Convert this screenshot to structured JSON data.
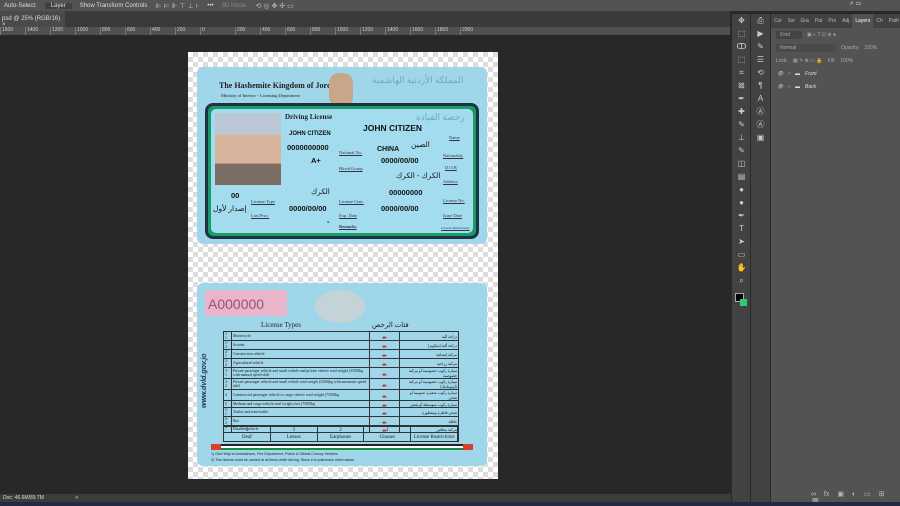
{
  "options_bar": {
    "auto_select": "Auto-Select:",
    "layer_select": "Layer",
    "show_transform": "Show Transform Controls",
    "mode_3d": "3D Mode:",
    "more": "•••"
  },
  "tab": {
    "title": "psd @ 25% (RGB/16)",
    "close": "×"
  },
  "ruler": [
    "1600",
    "1400",
    "1200",
    "1000",
    "800",
    "600",
    "400",
    "200",
    "0",
    "200",
    "400",
    "600",
    "800",
    "1000",
    "1200",
    "1400",
    "1600",
    "1800",
    "2000"
  ],
  "status": {
    "doc": "Doc: 46.6M/89.7M",
    "arrow": ">"
  },
  "panel": {
    "tabs": [
      "Col",
      "Sw",
      "Gra",
      "Pat",
      "Pro",
      "Adj",
      "Layers",
      "Ch",
      "Path"
    ],
    "active_tab": "Layers",
    "filter": "Kind",
    "blend": "Normal",
    "opacity_label": "Opacity:",
    "opacity": "100%",
    "lock": "Lock:",
    "fill_label": "Fill:",
    "fill": "100%",
    "layers": [
      "Front",
      "Back"
    ]
  },
  "front": {
    "kingdom": "The Hashemite Kingdom of Jordan",
    "ministry": "Ministry of Interior - Licensing Department",
    "ar_title": "المملكة الأردنية الهاشمية",
    "title": "Driving License",
    "ar_license": "رخصة القيادة",
    "name_big": "JOHN CITIZEN",
    "name_small": "JOHN CITIZEN",
    "name_label": "Name",
    "national_no": "0000000000",
    "national_label": "National No.",
    "nationality": "CHINA",
    "nationality_ar": "الصين",
    "nationality_label": "Nationality",
    "blood": "A+",
    "blood_label": "Blood Group",
    "dob": "0000/00/00",
    "dob_label": "D.O.B",
    "address": "الكرك - الكرك",
    "address_label": "Address",
    "license_type": "00",
    "license_type_label": "License Type",
    "license_cent": "الكرك",
    "license_cent_label": "License Cent.",
    "license_no": "00000000",
    "license_no_label": "License No.",
    "last_proc": "إصدار لأول",
    "last_proc_label": "Last Proc.",
    "exp": "0000/00/00",
    "exp_label": "Exp. Date",
    "issue": "0000/00/00",
    "issue_label": "Issue Date",
    "remarks_label": "Remarks",
    "restrictions_label": "License Restrictions",
    "dash": "-"
  },
  "back": {
    "serial": "A000000",
    "types_title": "License Types",
    "types_ar": "فئات الرخص",
    "website": "www.dvld.gov.jo",
    "rows": [
      [
        "1-1",
        "Motorcycle",
        "دراجة آلية"
      ],
      [
        "1-2",
        "Scooter",
        "دراجة آلية (سكوتر)"
      ],
      [
        "2-1",
        "Construction vehicle",
        "مركبة إنشائية"
      ],
      [
        "2-2",
        "Agricultural vehicle",
        "مركبة زراعية"
      ],
      [
        "3-1",
        "Private passenger vehicle and small vehicle and private vehicle total weight (3500)kg with manual speed shift",
        "سيارة ركوب خصوصية أو مركبة خصوصية"
      ],
      [
        "3-2",
        "Private passenger vehicle and small vehicle total weight (3500)kg with automatic speed shift",
        "سيارة ركوب خصوصية أو مركبة (أوتوماتيك)"
      ],
      [
        "4",
        "Commercial passenger vehicle or cargo vehicle total weight (7500)kg",
        "سيارة ركوب صغيرة عمومية أو شحن"
      ],
      [
        "5",
        "Medium and cargo vehicle total weight over (7500)kg",
        "سيارة ركوب متوسطة أو شحن"
      ],
      [
        "5-1",
        "Trailer and semi-trailer",
        "شحن قاطرة ومقطورة"
      ],
      [
        "6-2",
        "Bus",
        "حافلة"
      ],
      [
        "7",
        "Disabled vehicle",
        "مركبة معاقين"
      ]
    ],
    "conditions": [
      [
        "4",
        "Deaf"
      ],
      [
        "3",
        "Lenses"
      ],
      [
        "2",
        "Earphones"
      ],
      [
        "1",
        "Glasses"
      ],
      [
        "",
        "License Restrictions"
      ]
    ],
    "footer1": "1) Give Way to Ambulances, Fire Department, Police & Official Convoy Vehicles",
    "footer2": "2) This license must be carried at all times while driving. Show it to policemen when asked"
  }
}
